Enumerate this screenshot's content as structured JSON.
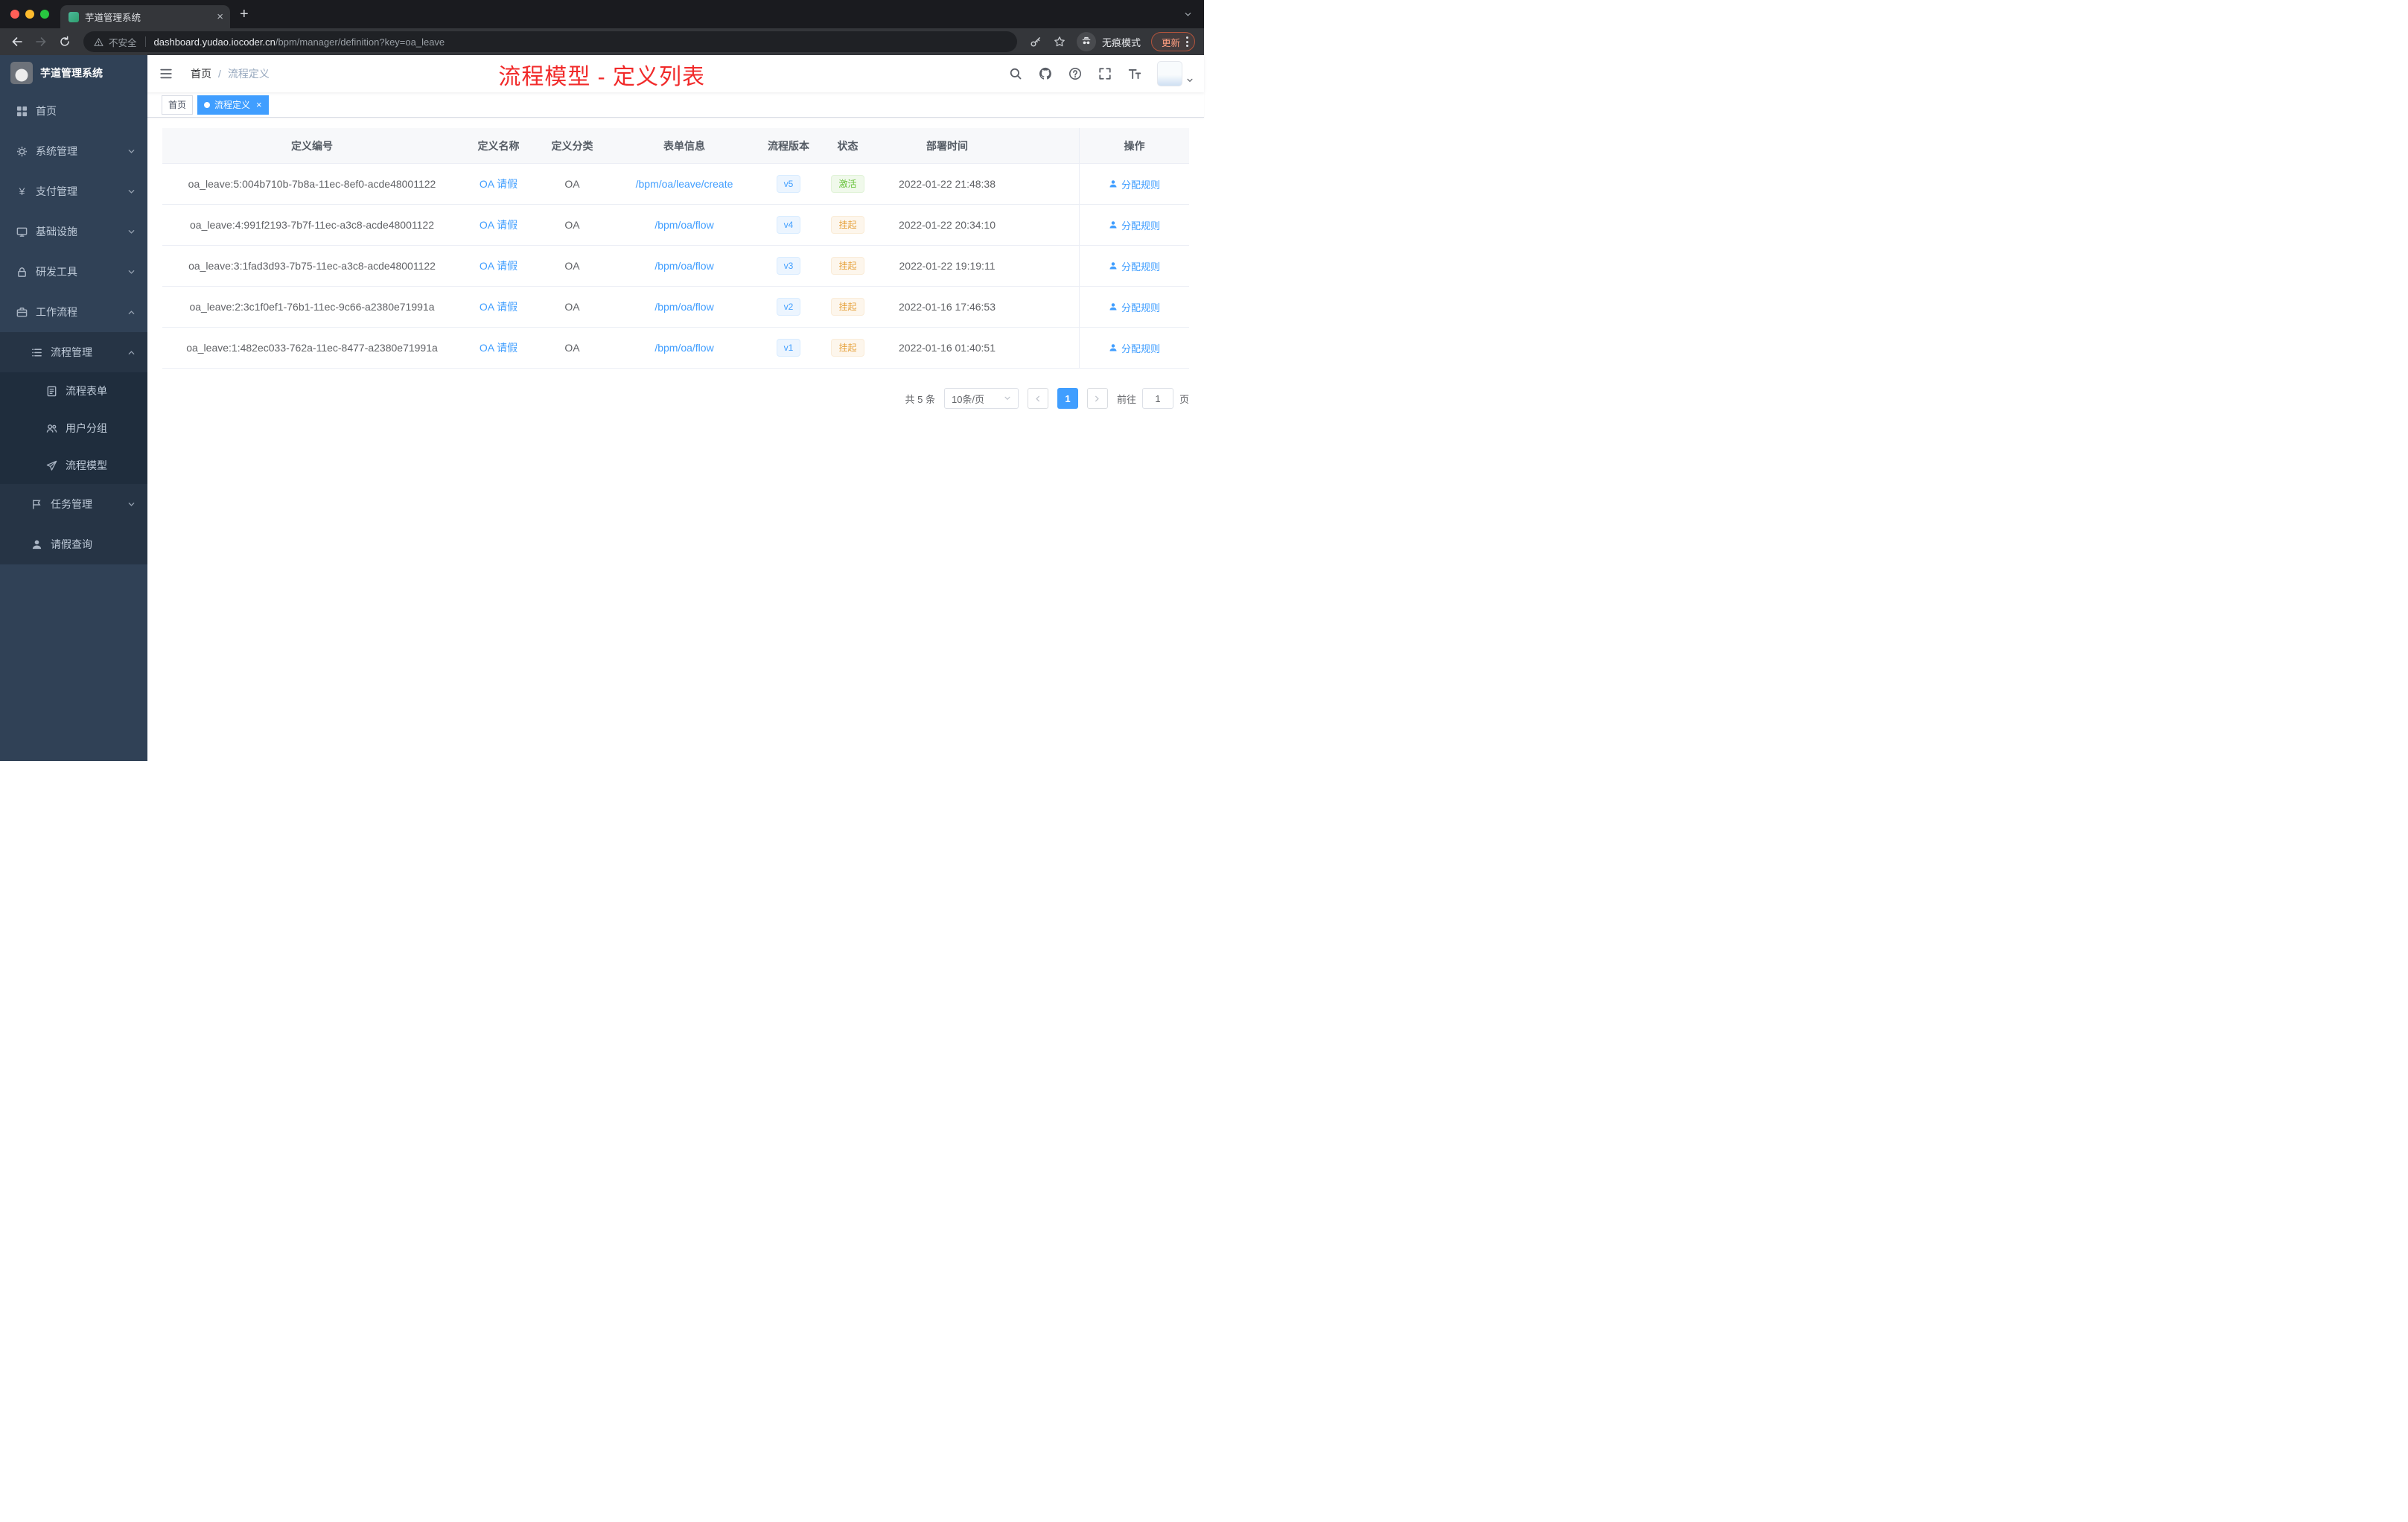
{
  "browser": {
    "tab_title": "芋道管理系统",
    "security_label": "不安全",
    "url_host": "dashboard.yudao.iocoder.cn",
    "url_path": "/bpm/manager/definition?key=oa_leave",
    "incognito_label": "无痕模式",
    "update_label": "更新"
  },
  "sidebar": {
    "logo_title": "芋道管理系统",
    "items": [
      {
        "label": "首页"
      },
      {
        "label": "系统管理"
      },
      {
        "label": "支付管理"
      },
      {
        "label": "基础设施"
      },
      {
        "label": "研发工具"
      },
      {
        "label": "工作流程"
      },
      {
        "label": "流程管理"
      },
      {
        "label": "流程表单"
      },
      {
        "label": "用户分组"
      },
      {
        "label": "流程模型"
      },
      {
        "label": "任务管理"
      },
      {
        "label": "请假查询"
      }
    ]
  },
  "header": {
    "breadcrumb_home": "首页",
    "breadcrumb_separator": "/",
    "breadcrumb_current": "流程定义",
    "annotation": "流程模型 - 定义列表"
  },
  "tags": {
    "home": "首页",
    "current": "流程定义"
  },
  "table": {
    "columns": {
      "id": "定义编号",
      "name": "定义名称",
      "category": "定义分类",
      "form": "表单信息",
      "version": "流程版本",
      "status": "状态",
      "time": "部署时间",
      "action": "操作"
    },
    "rows": [
      {
        "id": "oa_leave:5:004b710b-7b8a-11ec-8ef0-acde48001122",
        "name": "OA 请假",
        "category": "OA",
        "form": "/bpm/oa/leave/create",
        "version": "v5",
        "status": "激活",
        "time": "2022-01-22 21:48:38",
        "action": "分配规则"
      },
      {
        "id": "oa_leave:4:991f2193-7b7f-11ec-a3c8-acde48001122",
        "name": "OA 请假",
        "category": "OA",
        "form": "/bpm/oa/flow",
        "version": "v4",
        "status": "挂起",
        "time": "2022-01-22 20:34:10",
        "action": "分配规则"
      },
      {
        "id": "oa_leave:3:1fad3d93-7b75-11ec-a3c8-acde48001122",
        "name": "OA 请假",
        "category": "OA",
        "form": "/bpm/oa/flow",
        "version": "v3",
        "status": "挂起",
        "time": "2022-01-22 19:19:11",
        "action": "分配规则"
      },
      {
        "id": "oa_leave:2:3c1f0ef1-76b1-11ec-9c66-a2380e71991a",
        "name": "OA 请假",
        "category": "OA",
        "form": "/bpm/oa/flow",
        "version": "v2",
        "status": "挂起",
        "time": "2022-01-16 17:46:53",
        "action": "分配规则"
      },
      {
        "id": "oa_leave:1:482ec033-762a-11ec-8477-a2380e71991a",
        "name": "OA 请假",
        "category": "OA",
        "form": "/bpm/oa/flow",
        "version": "v1",
        "status": "挂起",
        "time": "2022-01-16 01:40:51",
        "action": "分配规则"
      }
    ]
  },
  "pagination": {
    "total": "共 5 条",
    "page_size": "10条/页",
    "page": "1",
    "goto_label": "前往",
    "goto_value": "1",
    "goto_unit": "页"
  },
  "colors": {
    "accent": "#409eff",
    "success": "#67c23a",
    "warning": "#e6a23c",
    "annotation_red": "#f12a2a",
    "sidebar_bg": "#304156"
  }
}
